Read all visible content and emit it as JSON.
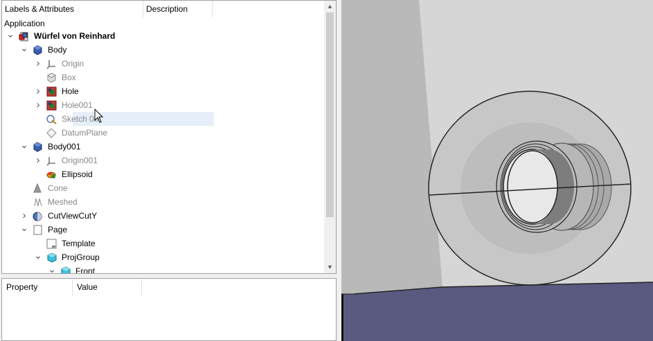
{
  "tree": {
    "header_col1": "Labels & Attributes",
    "header_col2": "Description",
    "application_label": "Application",
    "items": [
      {
        "label": "Würfel von Reinhard",
        "indent": 0,
        "arrow": "down",
        "icon": "document-icon",
        "bold": true,
        "dim": false
      },
      {
        "label": "Body",
        "indent": 1,
        "arrow": "down",
        "icon": "body-icon",
        "bold": false,
        "dim": false
      },
      {
        "label": "Origin",
        "indent": 2,
        "arrow": "right",
        "icon": "origin-icon",
        "bold": false,
        "dim": true
      },
      {
        "label": "Box",
        "indent": 2,
        "arrow": "",
        "icon": "box-icon",
        "bold": false,
        "dim": true
      },
      {
        "label": "Hole",
        "indent": 2,
        "arrow": "right",
        "icon": "hole-icon",
        "bold": false,
        "dim": false
      },
      {
        "label": "Hole001",
        "indent": 2,
        "arrow": "right",
        "icon": "hole-icon",
        "bold": false,
        "dim": true
      },
      {
        "label": "Sketch 00",
        "indent": 2,
        "arrow": "",
        "icon": "sketch-icon",
        "bold": false,
        "dim": true,
        "selected": true
      },
      {
        "label": "DatumPlane",
        "indent": 2,
        "arrow": "",
        "icon": "datum-plane-icon",
        "bold": false,
        "dim": true
      },
      {
        "label": "Body001",
        "indent": 1,
        "arrow": "down",
        "icon": "body-icon",
        "bold": false,
        "dim": false
      },
      {
        "label": "Origin001",
        "indent": 2,
        "arrow": "right",
        "icon": "origin-icon",
        "bold": false,
        "dim": true
      },
      {
        "label": "Ellipsoid",
        "indent": 2,
        "arrow": "",
        "icon": "ellipsoid-icon",
        "bold": false,
        "dim": false
      },
      {
        "label": "Cone",
        "indent": 1,
        "arrow": "",
        "icon": "cone-icon",
        "bold": false,
        "dim": true
      },
      {
        "label": "Meshed",
        "indent": 1,
        "arrow": "",
        "icon": "mesh-icon",
        "bold": false,
        "dim": true
      },
      {
        "label": "CutViewCutY",
        "indent": 1,
        "arrow": "right",
        "icon": "cutview-icon",
        "bold": false,
        "dim": false
      },
      {
        "label": "Page",
        "indent": 1,
        "arrow": "down",
        "icon": "page-icon",
        "bold": false,
        "dim": false
      },
      {
        "label": "Template",
        "indent": 2,
        "arrow": "",
        "icon": "template-icon",
        "bold": false,
        "dim": false
      },
      {
        "label": "ProjGroup",
        "indent": 2,
        "arrow": "down",
        "icon": "projgroup-icon",
        "bold": false,
        "dim": false
      },
      {
        "label": "Front",
        "indent": 3,
        "arrow": "down",
        "icon": "projgroup-icon",
        "bold": false,
        "dim": false
      }
    ]
  },
  "property": {
    "header_col1": "Property",
    "header_col2": "Value"
  },
  "colors": {
    "selection": "#e5eef9",
    "view_background": "#c8c8c8",
    "floor": "#5a5a80"
  }
}
